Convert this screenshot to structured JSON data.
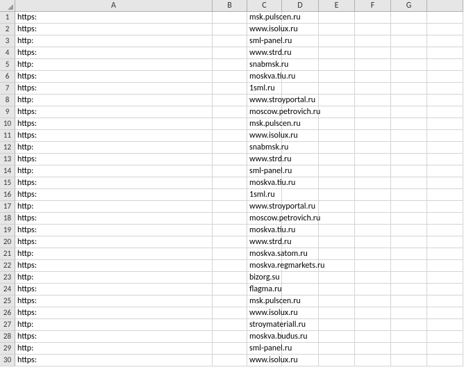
{
  "columns": [
    "A",
    "B",
    "C",
    "D",
    "E",
    "F",
    "G",
    ""
  ],
  "rows": [
    {
      "n": "1",
      "a": "https:",
      "c": "msk.pulscen.ru"
    },
    {
      "n": "2",
      "a": "https:",
      "c": "www.isolux.ru"
    },
    {
      "n": "3",
      "a": "http:",
      "c": "sml-panel.ru"
    },
    {
      "n": "4",
      "a": "https:",
      "c": "www.strd.ru"
    },
    {
      "n": "5",
      "a": "http:",
      "c": "snabmsk.ru"
    },
    {
      "n": "6",
      "a": "https:",
      "c": "moskva.tiu.ru"
    },
    {
      "n": "7",
      "a": "https:",
      "c": "1sml.ru"
    },
    {
      "n": "8",
      "a": "http:",
      "c": "www.stroyportal.ru"
    },
    {
      "n": "9",
      "a": "https:",
      "c": "moscow.petrovich.ru"
    },
    {
      "n": "10",
      "a": "https:",
      "c": "msk.pulscen.ru"
    },
    {
      "n": "11",
      "a": "https:",
      "c": "www.isolux.ru"
    },
    {
      "n": "12",
      "a": "http:",
      "c": "snabmsk.ru"
    },
    {
      "n": "13",
      "a": "https:",
      "c": "www.strd.ru"
    },
    {
      "n": "14",
      "a": "http:",
      "c": "sml-panel.ru"
    },
    {
      "n": "15",
      "a": "https:",
      "c": "moskva.tiu.ru"
    },
    {
      "n": "16",
      "a": "https:",
      "c": "1sml.ru"
    },
    {
      "n": "17",
      "a": "http:",
      "c": "www.stroyportal.ru"
    },
    {
      "n": "18",
      "a": "https:",
      "c": "moscow.petrovich.ru"
    },
    {
      "n": "19",
      "a": "https:",
      "c": "moskva.tiu.ru"
    },
    {
      "n": "20",
      "a": "https:",
      "c": "www.strd.ru"
    },
    {
      "n": "21",
      "a": "http:",
      "c": "moskva.satom.ru"
    },
    {
      "n": "22",
      "a": "https:",
      "c": "moskva.regmarkets.ru"
    },
    {
      "n": "23",
      "a": "http:",
      "c": "bizorg.su"
    },
    {
      "n": "24",
      "a": "https:",
      "c": "flagma.ru"
    },
    {
      "n": "25",
      "a": "https:",
      "c": "msk.pulscen.ru"
    },
    {
      "n": "26",
      "a": "https:",
      "c": "www.isolux.ru"
    },
    {
      "n": "27",
      "a": "http:",
      "c": "stroymateriall.ru"
    },
    {
      "n": "28",
      "a": "https:",
      "c": "moskva.budus.ru"
    },
    {
      "n": "29",
      "a": "http:",
      "c": "sml-panel.ru"
    },
    {
      "n": "30",
      "a": "https:",
      "c": "www.isolux.ru"
    }
  ]
}
